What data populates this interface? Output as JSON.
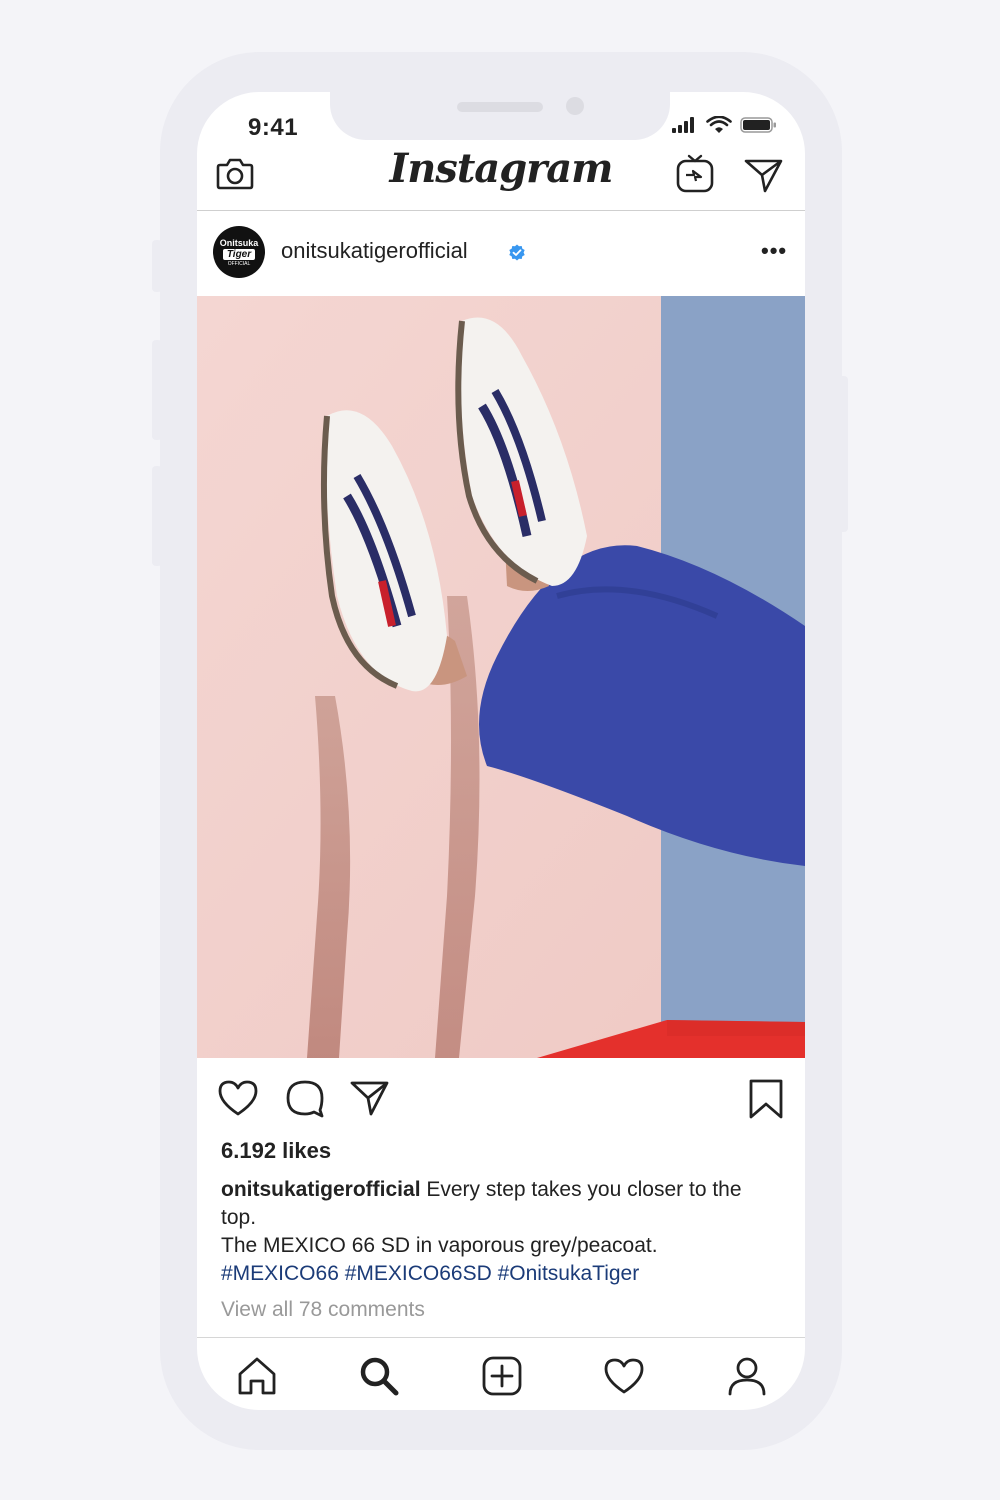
{
  "status_bar": {
    "time": "9:41"
  },
  "header": {
    "logo": "Instagram"
  },
  "post": {
    "username": "onitsukatigerofficial",
    "avatar_text": [
      "Onitsuka",
      "Tiger",
      "OFFICIAL"
    ],
    "likes": "6.192 likes",
    "caption_user": "onitsukatigerofficial",
    "caption_line1": " Every step takes you closer to the top.",
    "caption_line2": "The MEXICO 66 SD in vaporous grey/peacoat.",
    "hashtags": "#MEXICO66 #MEXICO66SD #OnitsukaTiger",
    "view_comments": "View all 78 comments"
  },
  "icons": {
    "header": [
      "camera-icon",
      "igtv-icon",
      "direct-message-icon"
    ],
    "actions": [
      "heart-icon",
      "comment-icon",
      "share-icon",
      "bookmark-icon"
    ],
    "bottom_nav": [
      "home-icon",
      "search-icon",
      "add-post-icon",
      "activity-heart-icon",
      "profile-icon"
    ]
  },
  "colors": {
    "verified_blue": "#3897f0",
    "hashtag": "#1b3b78",
    "accent_red": "#e4302c"
  }
}
